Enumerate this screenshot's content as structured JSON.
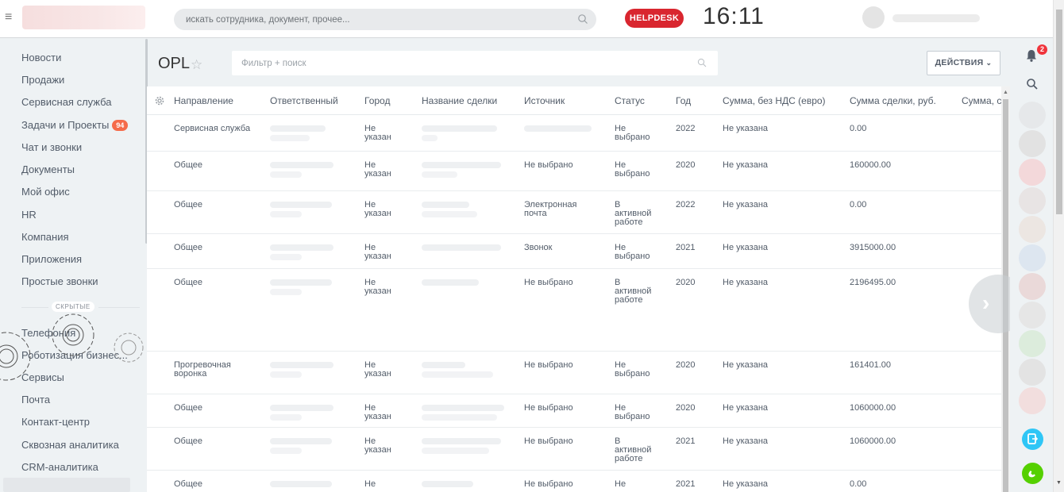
{
  "header": {
    "search_placeholder": "искать сотрудника, документ, прочее...",
    "helpdesk_label": "HELPDESK",
    "clock": "16:11"
  },
  "leftmenu": {
    "items": [
      {
        "label": "Новости"
      },
      {
        "label": "Продажи"
      },
      {
        "label": "Сервисная служба"
      },
      {
        "label": "Задачи и Проекты",
        "badge": "94"
      },
      {
        "label": "Чат и звонки"
      },
      {
        "label": "Документы"
      },
      {
        "label": "Мой офис"
      },
      {
        "label": "HR"
      },
      {
        "label": "Компания"
      },
      {
        "label": "Приложения"
      },
      {
        "label": "Простые звонки"
      }
    ],
    "hidden_label": "СКРЫТЫЕ",
    "hidden_items": [
      {
        "label": "Телефония"
      },
      {
        "label": "Роботизация бизнес..."
      },
      {
        "label": "Сервисы"
      },
      {
        "label": "Почта"
      },
      {
        "label": "Контакт-центр"
      },
      {
        "label": "Сквозная аналитика"
      },
      {
        "label": "CRM-аналитика"
      }
    ]
  },
  "main": {
    "title": "OPL",
    "filter_placeholder": "Фильтр + поиск",
    "actions_label": "ДЕЙСТВИЯ"
  },
  "grid": {
    "columns": [
      "Направление",
      "Ответственный",
      "Город",
      "Название сделки",
      "Источник",
      "Статус",
      "Год",
      "Сумма, без НДС (евро)",
      "Сумма сделки, руб.",
      "Сумма, с"
    ],
    "rows": [
      {
        "direction": "Сервисная служба",
        "city": "Не\nуказан",
        "source": "",
        "status": "Не\nвыбрано",
        "year": "2022",
        "sum_eur": "Не указана",
        "sum_rub": "0.00"
      },
      {
        "direction": "Общее",
        "city": "Не\nуказан",
        "source": "Не выбрано",
        "status": "Не\nвыбрано",
        "year": "2020",
        "sum_eur": "Не указана",
        "sum_rub": "160000.00"
      },
      {
        "direction": "Общее",
        "city": "Не\nуказан",
        "source": "Электронная\nпочта",
        "status": "В\nактивной\nработе",
        "year": "2022",
        "sum_eur": "Не указана",
        "sum_rub": "0.00"
      },
      {
        "direction": "Общее",
        "city": "Не\nуказан",
        "source": "Звонок",
        "status": "Не\nвыбрано",
        "year": "2021",
        "sum_eur": "Не указана",
        "sum_rub": "3915000.00"
      },
      {
        "direction": "Общее",
        "city": "Не\nуказан",
        "source": "Не выбрано",
        "status": "В\nактивной\nработе",
        "year": "2020",
        "sum_eur": "Не указана",
        "sum_rub": "2196495.00"
      },
      {
        "direction": "Прогревочная\nворонка",
        "city": "Не\nуказан",
        "source": "Не выбрано",
        "status": "Не\nвыбрано",
        "year": "2020",
        "sum_eur": "Не указана",
        "sum_rub": "161401.00"
      },
      {
        "direction": "Общее",
        "city": "Не\nуказан",
        "source": "Не выбрано",
        "status": "Не\nвыбрано",
        "year": "2020",
        "sum_eur": "Не указана",
        "sum_rub": "1060000.00"
      },
      {
        "direction": "Общее",
        "city": "Не\nуказан",
        "source": "Не выбрано",
        "status": "В\nактивной\nработе",
        "year": "2021",
        "sum_eur": "Не указана",
        "sum_rub": "1060000.00"
      },
      {
        "direction": "Общее",
        "city": "Не",
        "source": "Не выбрано",
        "status": "Не",
        "year": "2021",
        "sum_eur": "Не указана",
        "sum_rub": "0.00"
      }
    ]
  },
  "rightpanel": {
    "notification_count": "2"
  },
  "colors": {
    "helpdesk": "#d9262f",
    "badge": "#f56b4a",
    "accent_blue": "#2fc6f6",
    "call_green": "#55d000"
  }
}
